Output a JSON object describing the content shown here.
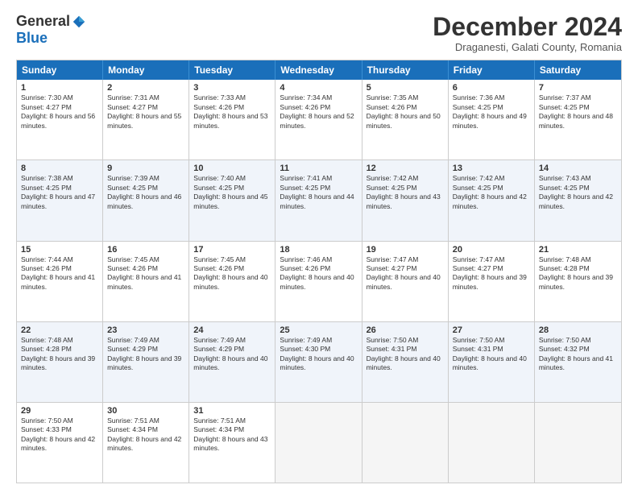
{
  "logo": {
    "general": "General",
    "blue": "Blue"
  },
  "title": "December 2024",
  "subtitle": "Draganesti, Galati County, Romania",
  "days": [
    "Sunday",
    "Monday",
    "Tuesday",
    "Wednesday",
    "Thursday",
    "Friday",
    "Saturday"
  ],
  "weeks": [
    [
      {
        "day": "1",
        "sunrise": "7:30 AM",
        "sunset": "4:27 PM",
        "daylight": "8 hours and 56 minutes."
      },
      {
        "day": "2",
        "sunrise": "7:31 AM",
        "sunset": "4:27 PM",
        "daylight": "8 hours and 55 minutes."
      },
      {
        "day": "3",
        "sunrise": "7:33 AM",
        "sunset": "4:26 PM",
        "daylight": "8 hours and 53 minutes."
      },
      {
        "day": "4",
        "sunrise": "7:34 AM",
        "sunset": "4:26 PM",
        "daylight": "8 hours and 52 minutes."
      },
      {
        "day": "5",
        "sunrise": "7:35 AM",
        "sunset": "4:26 PM",
        "daylight": "8 hours and 50 minutes."
      },
      {
        "day": "6",
        "sunrise": "7:36 AM",
        "sunset": "4:25 PM",
        "daylight": "8 hours and 49 minutes."
      },
      {
        "day": "7",
        "sunrise": "7:37 AM",
        "sunset": "4:25 PM",
        "daylight": "8 hours and 48 minutes."
      }
    ],
    [
      {
        "day": "8",
        "sunrise": "7:38 AM",
        "sunset": "4:25 PM",
        "daylight": "8 hours and 47 minutes."
      },
      {
        "day": "9",
        "sunrise": "7:39 AM",
        "sunset": "4:25 PM",
        "daylight": "8 hours and 46 minutes."
      },
      {
        "day": "10",
        "sunrise": "7:40 AM",
        "sunset": "4:25 PM",
        "daylight": "8 hours and 45 minutes."
      },
      {
        "day": "11",
        "sunrise": "7:41 AM",
        "sunset": "4:25 PM",
        "daylight": "8 hours and 44 minutes."
      },
      {
        "day": "12",
        "sunrise": "7:42 AM",
        "sunset": "4:25 PM",
        "daylight": "8 hours and 43 minutes."
      },
      {
        "day": "13",
        "sunrise": "7:42 AM",
        "sunset": "4:25 PM",
        "daylight": "8 hours and 42 minutes."
      },
      {
        "day": "14",
        "sunrise": "7:43 AM",
        "sunset": "4:25 PM",
        "daylight": "8 hours and 42 minutes."
      }
    ],
    [
      {
        "day": "15",
        "sunrise": "7:44 AM",
        "sunset": "4:26 PM",
        "daylight": "8 hours and 41 minutes."
      },
      {
        "day": "16",
        "sunrise": "7:45 AM",
        "sunset": "4:26 PM",
        "daylight": "8 hours and 41 minutes."
      },
      {
        "day": "17",
        "sunrise": "7:45 AM",
        "sunset": "4:26 PM",
        "daylight": "8 hours and 40 minutes."
      },
      {
        "day": "18",
        "sunrise": "7:46 AM",
        "sunset": "4:26 PM",
        "daylight": "8 hours and 40 minutes."
      },
      {
        "day": "19",
        "sunrise": "7:47 AM",
        "sunset": "4:27 PM",
        "daylight": "8 hours and 40 minutes."
      },
      {
        "day": "20",
        "sunrise": "7:47 AM",
        "sunset": "4:27 PM",
        "daylight": "8 hours and 39 minutes."
      },
      {
        "day": "21",
        "sunrise": "7:48 AM",
        "sunset": "4:28 PM",
        "daylight": "8 hours and 39 minutes."
      }
    ],
    [
      {
        "day": "22",
        "sunrise": "7:48 AM",
        "sunset": "4:28 PM",
        "daylight": "8 hours and 39 minutes."
      },
      {
        "day": "23",
        "sunrise": "7:49 AM",
        "sunset": "4:29 PM",
        "daylight": "8 hours and 39 minutes."
      },
      {
        "day": "24",
        "sunrise": "7:49 AM",
        "sunset": "4:29 PM",
        "daylight": "8 hours and 40 minutes."
      },
      {
        "day": "25",
        "sunrise": "7:49 AM",
        "sunset": "4:30 PM",
        "daylight": "8 hours and 40 minutes."
      },
      {
        "day": "26",
        "sunrise": "7:50 AM",
        "sunset": "4:31 PM",
        "daylight": "8 hours and 40 minutes."
      },
      {
        "day": "27",
        "sunrise": "7:50 AM",
        "sunset": "4:31 PM",
        "daylight": "8 hours and 40 minutes."
      },
      {
        "day": "28",
        "sunrise": "7:50 AM",
        "sunset": "4:32 PM",
        "daylight": "8 hours and 41 minutes."
      }
    ],
    [
      {
        "day": "29",
        "sunrise": "7:50 AM",
        "sunset": "4:33 PM",
        "daylight": "8 hours and 42 minutes."
      },
      {
        "day": "30",
        "sunrise": "7:51 AM",
        "sunset": "4:34 PM",
        "daylight": "8 hours and 42 minutes."
      },
      {
        "day": "31",
        "sunrise": "7:51 AM",
        "sunset": "4:34 PM",
        "daylight": "8 hours and 43 minutes."
      },
      null,
      null,
      null,
      null
    ]
  ],
  "labels": {
    "sunrise": "Sunrise:",
    "sunset": "Sunset:",
    "daylight": "Daylight:"
  }
}
